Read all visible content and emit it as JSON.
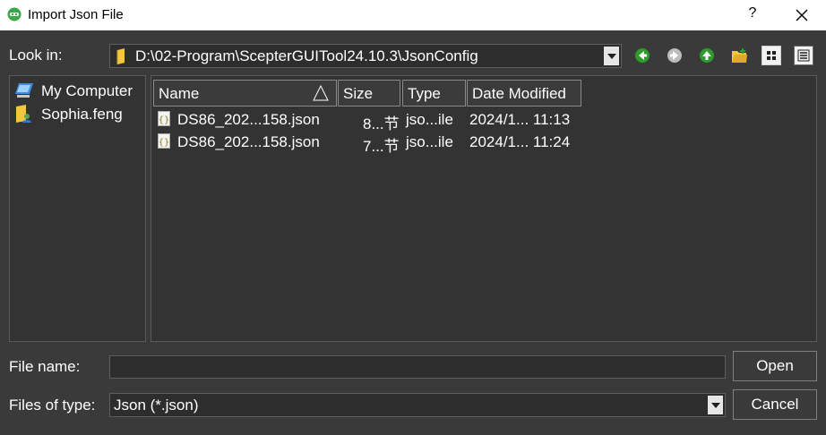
{
  "window": {
    "title": "Import Json File",
    "help_label": "?"
  },
  "toolbar": {
    "look_in_label": "Look in:",
    "path": "D:\\02-Program\\ScepterGUITool24.10.3\\JsonConfig",
    "icons": [
      "back-icon",
      "forward-icon",
      "up-icon",
      "new-folder-icon",
      "list-view-icon",
      "detail-view-icon"
    ]
  },
  "sidebar": {
    "items": [
      {
        "label": "My Computer",
        "icon": "computer-icon"
      },
      {
        "label": "Sophia.feng",
        "icon": "user-folder-icon"
      }
    ]
  },
  "file_list": {
    "columns": [
      "Name",
      "Size",
      "Type",
      "Date Modified"
    ],
    "rows": [
      {
        "name": "DS86_202...158.json",
        "size": "8...节",
        "type": "jso...ile",
        "date": "2024/1... 11:13"
      },
      {
        "name": "DS86_202...158.json",
        "size": "7...节",
        "type": "jso...ile",
        "date": "2024/1... 11:24"
      }
    ]
  },
  "footer": {
    "file_name_label": "File name:",
    "file_name_value": "",
    "files_of_type_label": "Files of type:",
    "files_of_type_value": "Json (*.json)",
    "open_label": "Open",
    "cancel_label": "Cancel"
  },
  "colors": {
    "background": "#3a3a3a",
    "titlebar": "#ffffff",
    "arrow_green": "#2e9b2e",
    "folder_yellow": "#f2c640"
  }
}
